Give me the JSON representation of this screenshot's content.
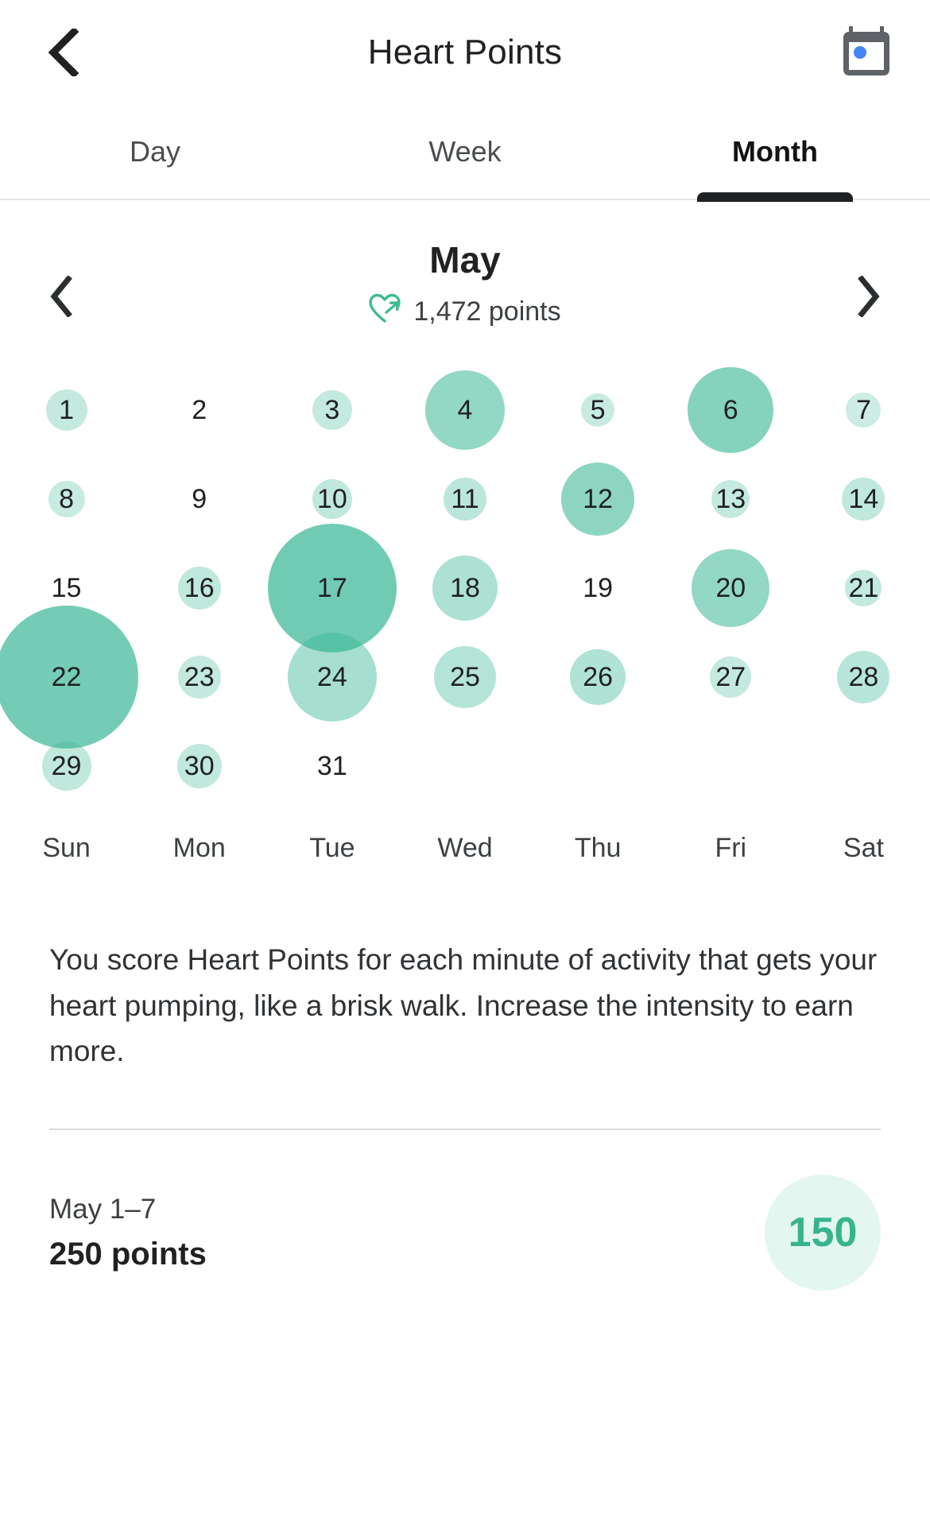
{
  "header": {
    "title": "Heart Points",
    "back_icon": "chevron-left-icon",
    "calendar_icon": "calendar-icon"
  },
  "tabs": [
    {
      "label": "Day",
      "active": false
    },
    {
      "label": "Week",
      "active": false
    },
    {
      "label": "Month",
      "active": true
    }
  ],
  "month_nav": {
    "prev_icon": "chevron-left-icon",
    "next_icon": "chevron-right-icon",
    "month": "May",
    "points_text": "1,472 points",
    "heart_icon": "heart-arrow-icon"
  },
  "weekdays": [
    "Sun",
    "Mon",
    "Tue",
    "Wed",
    "Thu",
    "Fri",
    "Sat"
  ],
  "description": "You score Heart Points for each minute of activity that gets your heart pumping, like a brisk walk. Increase the intensity to earn more.",
  "summary": {
    "range": "May 1–7",
    "points": "250 points",
    "badge": "150"
  },
  "colors": {
    "bubble": "#3ab795",
    "badge_bg": "#e3f6ef",
    "badge_text": "#37b48e",
    "heart_icon": "#3fba93",
    "accent_dark": "#1f2123",
    "calendar_body": "#5f6368",
    "calendar_dot": "#4285f4"
  },
  "chart_data": {
    "type": "scatter",
    "title": "May",
    "subtitle": "1,472 points",
    "xlabel": "",
    "ylabel": "",
    "note": "Bubble calendar: bubble diameter encodes daily Heart Points; opacity scales with value.",
    "categories": [
      "Sun",
      "Mon",
      "Tue",
      "Wed",
      "Thu",
      "Fri",
      "Sat"
    ],
    "weeks": [
      [
        {
          "day": "1",
          "col": 0,
          "size": 52,
          "opacity": 0.3
        },
        {
          "day": "2",
          "col": 1,
          "size": 0,
          "opacity": 0
        },
        {
          "day": "3",
          "col": 2,
          "size": 50,
          "opacity": 0.3
        },
        {
          "day": "4",
          "col": 3,
          "size": 100,
          "opacity": 0.55
        },
        {
          "day": "5",
          "col": 4,
          "size": 42,
          "opacity": 0.28
        },
        {
          "day": "6",
          "col": 5,
          "size": 108,
          "opacity": 0.62
        },
        {
          "day": "7",
          "col": 6,
          "size": 44,
          "opacity": 0.26
        }
      ],
      [
        {
          "day": "8",
          "col": 0,
          "size": 46,
          "opacity": 0.28
        },
        {
          "day": "9",
          "col": 1,
          "size": 0,
          "opacity": 0
        },
        {
          "day": "10",
          "col": 2,
          "size": 50,
          "opacity": 0.32
        },
        {
          "day": "11",
          "col": 3,
          "size": 54,
          "opacity": 0.34
        },
        {
          "day": "12",
          "col": 4,
          "size": 92,
          "opacity": 0.58
        },
        {
          "day": "13",
          "col": 5,
          "size": 48,
          "opacity": 0.3
        },
        {
          "day": "14",
          "col": 6,
          "size": 54,
          "opacity": 0.32
        }
      ],
      [
        {
          "day": "15",
          "col": 0,
          "size": 0,
          "opacity": 0
        },
        {
          "day": "16",
          "col": 1,
          "size": 54,
          "opacity": 0.32
        },
        {
          "day": "17",
          "col": 2,
          "size": 162,
          "opacity": 0.72
        },
        {
          "day": "18",
          "col": 3,
          "size": 82,
          "opacity": 0.42
        },
        {
          "day": "19",
          "col": 4,
          "size": 0,
          "opacity": 0
        },
        {
          "day": "20",
          "col": 5,
          "size": 98,
          "opacity": 0.55
        },
        {
          "day": "21",
          "col": 6,
          "size": 46,
          "opacity": 0.3
        }
      ],
      [
        {
          "day": "22",
          "col": 0,
          "size": 180,
          "opacity": 0.7
        },
        {
          "day": "23",
          "col": 1,
          "size": 54,
          "opacity": 0.3
        },
        {
          "day": "24",
          "col": 2,
          "size": 112,
          "opacity": 0.45
        },
        {
          "day": "25",
          "col": 3,
          "size": 78,
          "opacity": 0.38
        },
        {
          "day": "26",
          "col": 4,
          "size": 70,
          "opacity": 0.4
        },
        {
          "day": "27",
          "col": 5,
          "size": 52,
          "opacity": 0.3
        },
        {
          "day": "28",
          "col": 6,
          "size": 66,
          "opacity": 0.36
        }
      ],
      [
        {
          "day": "29",
          "col": 0,
          "size": 62,
          "opacity": 0.32
        },
        {
          "day": "30",
          "col": 1,
          "size": 56,
          "opacity": 0.32
        },
        {
          "day": "31",
          "col": 2,
          "size": 0,
          "opacity": 0
        },
        {
          "day": "",
          "col": 3,
          "size": 0,
          "opacity": 0
        },
        {
          "day": "",
          "col": 4,
          "size": 0,
          "opacity": 0
        },
        {
          "day": "",
          "col": 5,
          "size": 0,
          "opacity": 0
        },
        {
          "day": "",
          "col": 6,
          "size": 0,
          "opacity": 0
        }
      ]
    ]
  }
}
